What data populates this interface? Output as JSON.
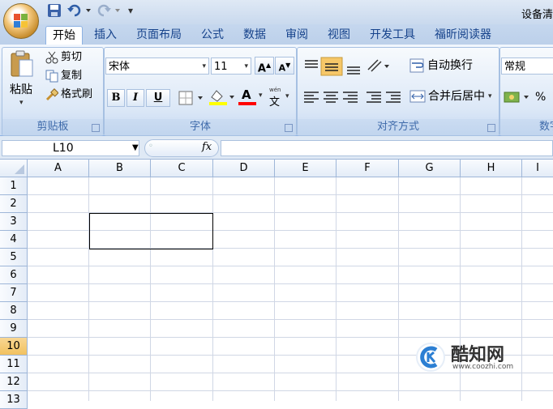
{
  "window": {
    "title": "设备清"
  },
  "qat": {
    "save_icon": "save-icon",
    "undo_icon": "undo-icon",
    "redo_icon": "redo-icon",
    "customize": "▾"
  },
  "tabs": [
    "开始",
    "插入",
    "页面布局",
    "公式",
    "数据",
    "审阅",
    "视图",
    "开发工具",
    "福昕阅读器"
  ],
  "active_tab": "开始",
  "clipboard": {
    "paste": "粘贴",
    "cut": "剪切",
    "copy": "复制",
    "format_painter": "格式刷",
    "label": "剪贴板"
  },
  "font": {
    "name": "宋体",
    "size": "11",
    "grow": "A",
    "shrink": "A",
    "bold": "B",
    "italic": "I",
    "underline": "U",
    "font_color_letter": "A",
    "phonetic": "wén",
    "label": "字体"
  },
  "align": {
    "wrap": "自动换行",
    "merge": "合并后居中",
    "label": "对齐方式"
  },
  "number": {
    "format": "常规",
    "percent": "%",
    "label": "数字"
  },
  "formula_bar": {
    "name_box": "L10",
    "fx": "fx",
    "value": ""
  },
  "sheet": {
    "columns": [
      "A",
      "B",
      "C",
      "D",
      "E",
      "F",
      "G",
      "H",
      "I"
    ],
    "rows": [
      "1",
      "2",
      "3",
      "4",
      "5",
      "6",
      "7",
      "8",
      "9",
      "10",
      "11",
      "12",
      "13"
    ],
    "selected_row": "10",
    "merged_range": "B3:C4"
  },
  "watermark": {
    "brand": "酷知网",
    "url": "www.coozhi.com"
  },
  "colors": {
    "accent": "#15428b",
    "ribbon": "#dbe7f6",
    "selected_header": "#f1c15f",
    "grid": "#d0d7e5"
  }
}
